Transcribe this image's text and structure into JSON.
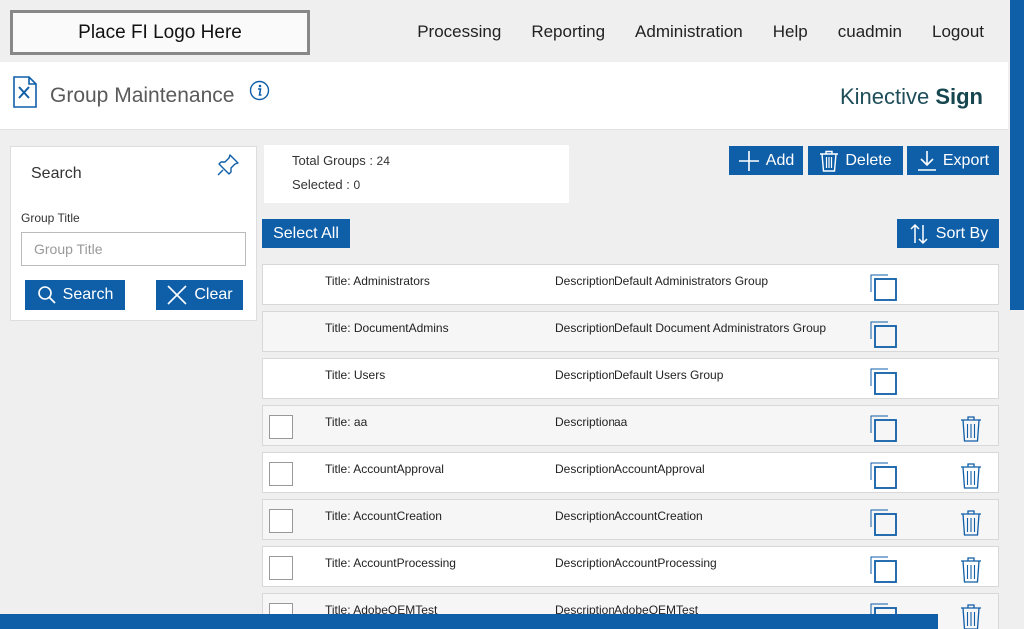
{
  "header": {
    "logo_placeholder": "Place FI Logo Here",
    "nav": [
      "Processing",
      "Reporting",
      "Administration",
      "Help",
      "cuadmin",
      "Logout"
    ]
  },
  "page": {
    "title": "Group Maintenance",
    "brand_light": "Kinective ",
    "brand_bold": "Sign"
  },
  "search": {
    "heading": "Search",
    "field_label": "Group Title",
    "placeholder": "Group Title",
    "value": "",
    "search_button": "Search",
    "clear_button": "Clear"
  },
  "counts": {
    "total_label": "Total Groups : ",
    "total_value": "24",
    "selected_label": "Selected : ",
    "selected_value": "0"
  },
  "toolbar": {
    "add": "Add",
    "delete": "Delete",
    "export": "Export",
    "select_all": "Select All",
    "sort_by": "Sort By"
  },
  "groups": [
    {
      "title": "Title: Administrators",
      "desc_label": "Description:",
      "desc_value": "Default Administrators Group"
    },
    {
      "title": "Title: DocumentAdmins",
      "desc_label": "Description:",
      "desc_value": "Default Document Administrators Group"
    },
    {
      "title": "Title: Users",
      "desc_label": "Description:",
      "desc_value": "Default Users Group"
    },
    {
      "title": "Title: aa",
      "desc_label": "Description:",
      "desc_value": "aa"
    },
    {
      "title": "Title: AccountApproval",
      "desc_label": "Description:",
      "desc_value": "AccountApproval"
    },
    {
      "title": "Title: AccountCreation",
      "desc_label": "Description:",
      "desc_value": "AccountCreation"
    },
    {
      "title": "Title: AccountProcessing",
      "desc_label": "Description:",
      "desc_value": "AccountProcessing"
    },
    {
      "title": "Title: AdobeOEMTest",
      "desc_label": "Description:",
      "desc_value": "AdobeOEMTest"
    }
  ],
  "colors": {
    "primary": "#0f5ea8",
    "brand_text": "#16464f",
    "background": "#efefef"
  }
}
